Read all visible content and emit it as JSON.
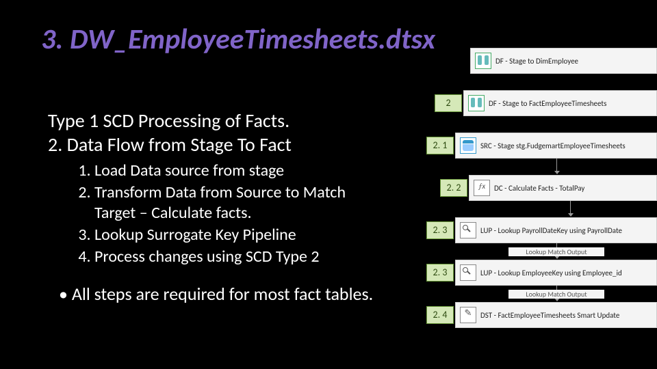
{
  "title": "3. DW_EmployeeTimesheets.dtsx",
  "sub1": "Type 1 SCD Processing of Facts.",
  "sub2": "2.  Data Flow from Stage To Fact",
  "steps": [
    "Load Data source from stage",
    "Transform Data from Source to Match Target – Calculate facts.",
    "Lookup Surrogate Key Pipeline",
    "Process changes using SCD Type 2"
  ],
  "bullet": "• All steps are required for most fact tables.",
  "nodes": [
    {
      "tag": "",
      "icon": "i-df",
      "label": "DF - Stage to DimEmployee"
    },
    {
      "tag": "2",
      "icon": "i-df",
      "label": "DF - Stage to FactEmployeeTimesheets"
    },
    {
      "tag": "2. 1",
      "icon": "i-src",
      "label": "SRC - Stage stg.FudgemartEmployeeTimesheets"
    },
    {
      "tag": "2. 2",
      "icon": "i-dc",
      "label": "DC - Calculate Facts - TotalPay"
    },
    {
      "tag": "2. 3",
      "icon": "i-lup",
      "label": "LUP - Lookup PayrollDateKey using PayrollDate"
    },
    {
      "tag": "2. 3",
      "icon": "i-lup",
      "label": "LUP - Lookup EmployeeKey using Employee_id"
    },
    {
      "tag": "2. 4",
      "icon": "i-dst",
      "label": "DST - FactEmployeeTimesheets Smart Update"
    }
  ],
  "arrowLabels": {
    "a1": "Lookup Match Output",
    "a2": "Lookup Match Output"
  }
}
